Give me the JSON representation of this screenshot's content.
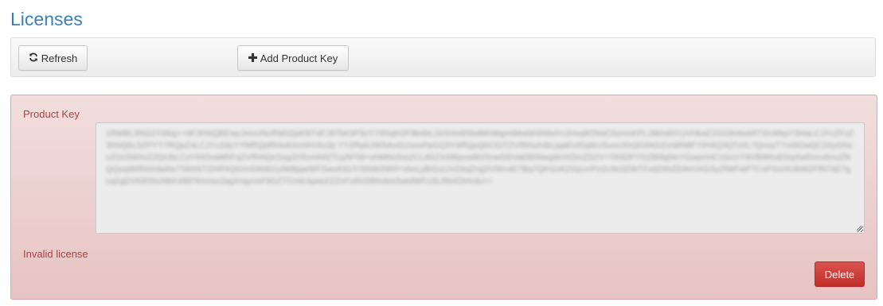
{
  "page": {
    "title": "Licenses"
  },
  "toolbar": {
    "refresh_label": "Refresh",
    "refresh_icon": "refresh-icon",
    "add_label": "Add Product Key",
    "add_icon": "plus-icon"
  },
  "license": {
    "product_key_label": "Product Key",
    "product_key_value": "1RMBL3NG2Yt9kg++9F3hNQBEiayJmvUNvRM0ZpKl9T4FJ87bK9F9zYY8SqhOF9b4bL1kIIHm8SbdMHMgmtbbaW4N9xFcJHxq8ONaC6zmnKPLJ8khdHYyVHkaZ2GG8n8xkRTScWkpY3HaLCJYcZFsZ3hNQbL0ZPYY7RQpZ4LCJYcZdyYYMRQpRHs4lJcmhV4u3p YYZRpbJWSAvGUooxPpGQ3Y4RQpQ6CGtTZVRhlumibLjqaEUtGpbUSuooXhQG9ADZmWN8FYtH4Q3QTz0L7QnoyTYm5DwQC24yGNvuZOc5W4zZZQUbLCoYlHOvaMhFqZVRHiQeSxg2HSvmhtlZTuyhFh6+xHMNcfoeZCLA5ZX4WpxwBOSnwDDVaDBINwgAHXDmZD2V+TA5DPYSZBl9gNnYGwpnHC1GuVY9VBWhoEDqXwDonxbnuZNQQsqWtRNXdwNx7SNVkTZHRXQGmSWdO1dW8jqwWFSwuKtGYrSNW3Wtf+VkeLyBiGzUVZAqZngZVWn4E7Bq7QKGoKZGjuvrPcGc9x3ZWTFxdZ6hZDAVsXGSyZfWFwPTCsPSxIXUbWZFRt7dZ7gcqZgDVKBShzNbK49tF9mnaz2agXrqyrmF9GZTCmbJqawZZZnFvdVOBhvkisSwtdWFuSLRbXDHvdu+=",
    "status_text": "Invalid license",
    "delete_label": "Delete"
  },
  "colors": {
    "title": "#3a7fba",
    "error_text": "#a94442",
    "panel_bg": "#f2dede",
    "danger_button": "#d9534f"
  }
}
